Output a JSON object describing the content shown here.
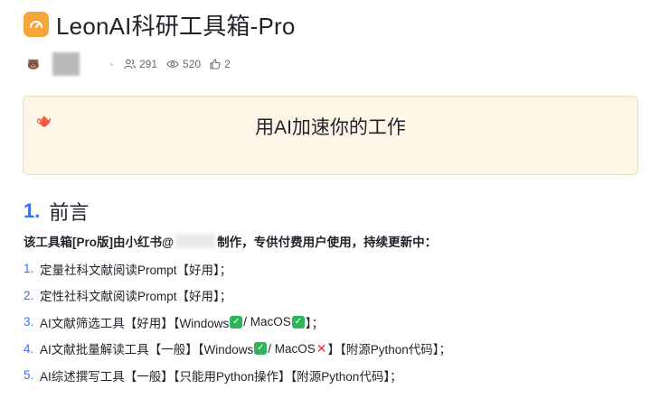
{
  "doc": {
    "title": "LeonAI科研工具箱-Pro",
    "icon": "gauge-icon",
    "accent": "#f6a53a"
  },
  "meta": {
    "followers": "291",
    "views": "520",
    "likes": "2"
  },
  "callout": {
    "icon": "teapot-icon",
    "text": "用AI加速你的工作"
  },
  "section": {
    "number": "1.",
    "heading": "前言"
  },
  "intro": {
    "before": "该工具箱[Pro版]由小红书@",
    "after": "制作，专供付费用户使用，持续更新中："
  },
  "list": [
    {
      "num": "1.",
      "text": "定量社科文献阅读Prompt【好用】；"
    },
    {
      "num": "2.",
      "text": "定性社科文献阅读Prompt【好用】；"
    },
    {
      "num": "3.",
      "a": "AI文献筛选工具【好用】【Windows",
      "b": " / MacOS",
      "c": "】；"
    },
    {
      "num": "4.",
      "a": "AI文献批量解读工具【一般】【Windows",
      "b": " / MacOS",
      "c": "】【附源Python代码】；"
    },
    {
      "num": "5.",
      "text": "AI综述撰写工具【一般】【只能用Python操作】【附源Python代码】；"
    }
  ],
  "colors": {
    "link_blue": "#3370ff",
    "callout_bg": "#fef5e6",
    "check_green": "#2fb35b",
    "cross_red": "#e53935"
  }
}
